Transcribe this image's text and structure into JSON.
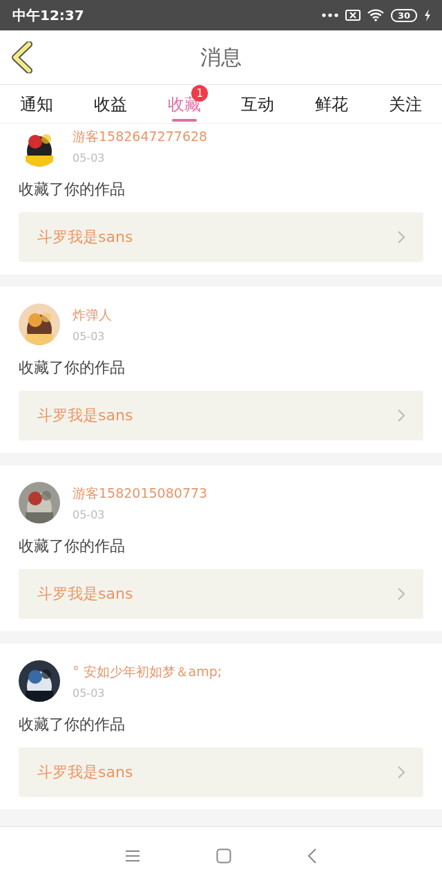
{
  "status_bar": {
    "time": "中午12:37",
    "battery": "30"
  },
  "header": {
    "title": "消息"
  },
  "tabs": [
    {
      "label": "通知",
      "selected": false
    },
    {
      "label": "收益",
      "selected": false
    },
    {
      "label": "收藏",
      "selected": true,
      "badge": "1"
    },
    {
      "label": "互动",
      "selected": false
    },
    {
      "label": "鲜花",
      "selected": false
    },
    {
      "label": "关注",
      "selected": false
    }
  ],
  "messages": [
    {
      "name": "游客1582647277628",
      "date": "05-03",
      "action": "收藏了你的作品",
      "work": "斗罗我是sans"
    },
    {
      "name": "炸弹人",
      "date": "05-03",
      "action": "收藏了你的作品",
      "work": "斗罗我是sans"
    },
    {
      "name": "游客1582015080773",
      "date": "05-03",
      "action": "收藏了你的作品",
      "work": "斗罗我是sans"
    },
    {
      "name": "° 安如少年初如梦＆amp;",
      "date": "05-03",
      "action": "收藏了你的作品",
      "work": "斗罗我是sans"
    }
  ]
}
